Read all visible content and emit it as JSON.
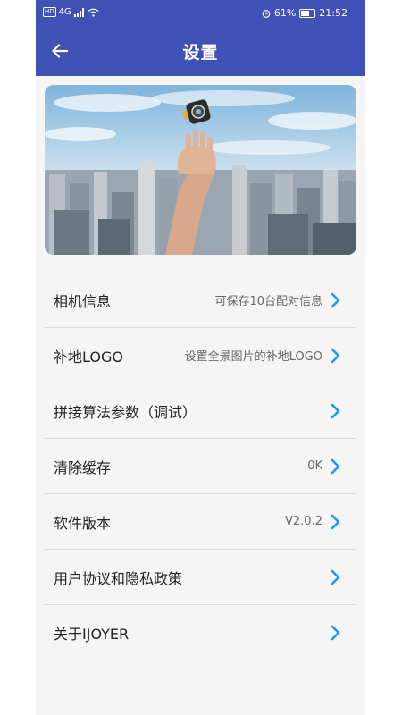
{
  "status_bar": {
    "network": "HD",
    "signal": "4G",
    "battery_percent": "61%",
    "time": "21:52"
  },
  "app_bar": {
    "title": "设置",
    "back_icon": "arrow-left-icon"
  },
  "banner": {
    "description_icon": "hand-holding-camera-over-city-image"
  },
  "settings": [
    {
      "label": "相机信息",
      "value": "可保存10台配对信息"
    },
    {
      "label": "补地LOGO",
      "value": "设置全景图片的补地LOGO"
    },
    {
      "label": "拼接算法参数（调试）",
      "value": ""
    },
    {
      "label": "清除缓存",
      "value": "0K"
    },
    {
      "label": "软件版本",
      "value": "V2.0.2"
    },
    {
      "label": "用户协议和隐私政策",
      "value": ""
    },
    {
      "label": "关于IJOYER",
      "value": ""
    }
  ],
  "colors": {
    "primary": "#3f51b5",
    "chevron": "#2196f3",
    "background": "#f5f5f5"
  }
}
